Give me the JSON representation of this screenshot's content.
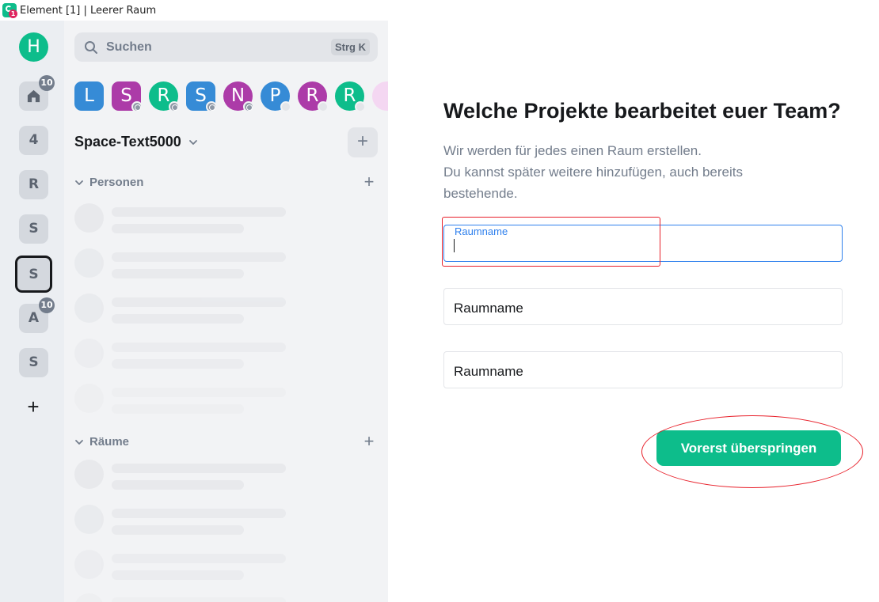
{
  "window": {
    "title": "Element [1] | Leerer Raum",
    "app_badge": "1"
  },
  "spacebar": {
    "user_avatar": "H",
    "home_badge": "10",
    "spaces": [
      {
        "letter": "4"
      },
      {
        "letter": "R"
      },
      {
        "letter": "S"
      },
      {
        "letter": "S",
        "selected": true
      },
      {
        "letter": "A",
        "badge": "10"
      },
      {
        "letter": "S"
      }
    ],
    "add_label": "+"
  },
  "roomlist": {
    "search_placeholder": "Suchen",
    "search_shortcut": "Strg K",
    "breadcrumbs": [
      {
        "letter": "L",
        "color": "#368bd6"
      },
      {
        "letter": "S",
        "color": "#ac3ba8"
      },
      {
        "letter": "R",
        "color": "#0dbd8b"
      },
      {
        "letter": "S",
        "color": "#368bd6"
      },
      {
        "letter": "N",
        "color": "#ac3ba8"
      },
      {
        "letter": "P",
        "color": "#368bd6"
      },
      {
        "letter": "R",
        "color": "#ac3ba8"
      },
      {
        "letter": "R",
        "color": "#0dbd8b"
      }
    ],
    "space_name": "Space-Text5000",
    "add_button": "+",
    "sections": {
      "people": "Personen",
      "rooms": "Räume"
    }
  },
  "main": {
    "heading": "Welche Projekte bearbeitet euer Team?",
    "description_line1": "Wir werden für jedes einen Raum erstellen.",
    "description_line2": "Du kannst später weitere hinzufügen, auch bereits bestehende.",
    "field1_label": "Raumname",
    "field2_placeholder": "Raumname",
    "field3_placeholder": "Raumname",
    "skip_button": "Vorerst überspringen"
  },
  "colors": {
    "accent": "#0dbd8b",
    "focus": "#2f80ed",
    "annotation": "#e8202a"
  }
}
